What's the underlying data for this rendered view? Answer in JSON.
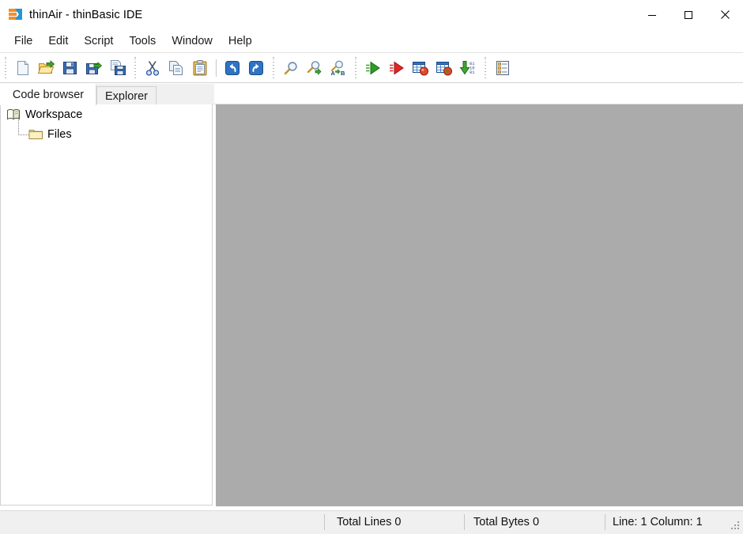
{
  "window": {
    "title": "thinAir - thinBasic IDE",
    "app_icon": "thinbasic-logo-icon",
    "controls": {
      "minimize": "minimize-icon",
      "maximize": "maximize-icon",
      "close": "close-icon"
    }
  },
  "menu": {
    "items": [
      {
        "label": "File"
      },
      {
        "label": "Edit"
      },
      {
        "label": "Script"
      },
      {
        "label": "Tools"
      },
      {
        "label": "Window"
      },
      {
        "label": "Help"
      }
    ]
  },
  "toolbar": {
    "groups": [
      {
        "name": "file-group",
        "buttons": [
          {
            "icon": "new-file-icon",
            "tooltip": "New"
          },
          {
            "icon": "open-folder-icon",
            "tooltip": "Open"
          },
          {
            "icon": "save-icon",
            "tooltip": "Save"
          },
          {
            "icon": "save-as-icon",
            "tooltip": "Save As"
          },
          {
            "icon": "save-all-icon",
            "tooltip": "Save All"
          }
        ]
      },
      {
        "name": "edit-group",
        "buttons": [
          {
            "icon": "cut-icon",
            "tooltip": "Cut"
          },
          {
            "icon": "copy-icon",
            "tooltip": "Copy"
          },
          {
            "icon": "paste-icon",
            "tooltip": "Paste"
          },
          {
            "icon": "undo-icon",
            "tooltip": "Undo"
          },
          {
            "icon": "redo-icon",
            "tooltip": "Redo"
          }
        ]
      },
      {
        "name": "search-group",
        "buttons": [
          {
            "icon": "find-icon",
            "tooltip": "Find"
          },
          {
            "icon": "find-next-icon",
            "tooltip": "Find Next"
          },
          {
            "icon": "replace-icon",
            "tooltip": "Replace"
          }
        ]
      },
      {
        "name": "run-group",
        "buttons": [
          {
            "icon": "run-icon",
            "tooltip": "Run"
          },
          {
            "icon": "run-debug-icon",
            "tooltip": "Run in debug"
          },
          {
            "icon": "check-syntax-icon",
            "tooltip": "Check syntax"
          },
          {
            "icon": "preparse-icon",
            "tooltip": "Preparse"
          },
          {
            "icon": "compile-icon",
            "tooltip": "Compile"
          }
        ]
      },
      {
        "name": "view-group",
        "buttons": [
          {
            "icon": "properties-list-icon",
            "tooltip": "Properties"
          }
        ]
      }
    ]
  },
  "left_dock": {
    "tabs": [
      {
        "label": "Code browser",
        "active": true
      },
      {
        "label": "Explorer",
        "active": false
      }
    ],
    "tree": {
      "root": {
        "label": "Workspace",
        "icon": "open-book-icon"
      },
      "children": [
        {
          "label": "Files",
          "icon": "folder-icon"
        }
      ]
    }
  },
  "editor": {
    "background_color": "#ababab",
    "open_documents": []
  },
  "status_bar": {
    "total_lines": "Total Lines 0",
    "total_bytes": "Total Bytes 0",
    "caret_position": "Line: 1 Column: 1",
    "resize_grip": "resize-grip-icon"
  },
  "colors": {
    "mdi_background": "#ababab",
    "window_background": "#ffffff",
    "status_background": "#f0f0f0",
    "accent_orange": "#f18f2c",
    "accent_blue": "#2196d8"
  }
}
